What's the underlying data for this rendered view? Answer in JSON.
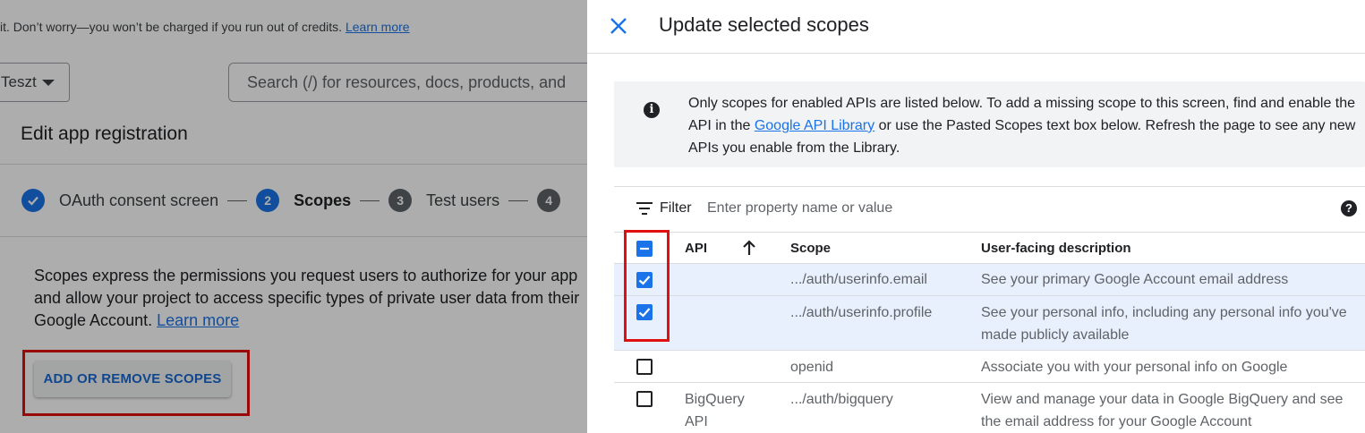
{
  "background": {
    "banner": {
      "text": "it. Don’t worry—you won’t be charged if you run out of credits. ",
      "link": "Learn more"
    },
    "project_selector": {
      "label": "Teszt"
    },
    "search": {
      "placeholder": "Search (/) for resources, docs, products, and"
    },
    "page_title": "Edit app registration",
    "stepper": [
      {
        "number": "",
        "label": "OAuth consent screen",
        "state": "done"
      },
      {
        "number": "2",
        "label": "Scopes",
        "state": "active"
      },
      {
        "number": "3",
        "label": "Test users",
        "state": "idle"
      },
      {
        "number": "4",
        "label": "",
        "state": "idle"
      }
    ],
    "description": {
      "text": "Scopes express the permissions you request users to authorize for your app and allow your project to access specific types of private user data from their Google Account. ",
      "link": "Learn more"
    },
    "add_button": "ADD OR REMOVE SCOPES"
  },
  "drawer": {
    "title": "Update selected scopes",
    "info": {
      "text_before": "Only scopes for enabled APIs are listed below. To add a missing scope to this screen, find and enable the API in the ",
      "link": "Google API Library",
      "text_after": " or use the Pasted Scopes text box below. Refresh the page to see any new APIs you enable from the Library."
    },
    "filter": {
      "label": "Filter",
      "placeholder": "Enter property name or value"
    },
    "columns": {
      "api": "API",
      "scope": "Scope",
      "description": "User-facing description"
    },
    "rows": [
      {
        "checked": true,
        "api": "",
        "scope": ".../auth/userinfo.email",
        "description": "See your primary Google Account email address"
      },
      {
        "checked": true,
        "api": "",
        "scope": ".../auth/userinfo.profile",
        "description": "See your personal info, including any personal info you've made publicly available"
      },
      {
        "checked": false,
        "api": "",
        "scope": "openid",
        "description": "Associate you with your personal info on Google"
      },
      {
        "checked": false,
        "api": "BigQuery API",
        "scope": ".../auth/bigquery",
        "description": "View and manage your data in Google BigQuery and see the email address for your Google Account"
      }
    ]
  },
  "colors": {
    "accent": "#1a73e8",
    "highlight": "#e01010",
    "selected_row": "#e8f0fe"
  }
}
